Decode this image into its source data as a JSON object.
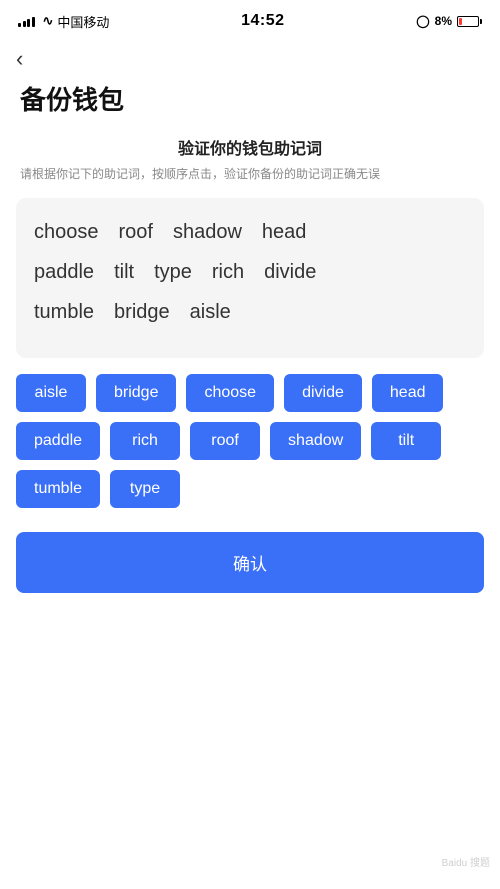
{
  "statusBar": {
    "carrier": "中国移动",
    "time": "14:52",
    "battery": "8%"
  },
  "back": {
    "icon": "‹"
  },
  "pageTitle": "备份钱包",
  "section": {
    "title": "验证你的钱包助记词",
    "desc": "请根据你记下的助记词，按顺序点击，验证你备份的助记词正确无误"
  },
  "displayWords": {
    "row1": [
      "choose",
      "roof",
      "shadow",
      "head"
    ],
    "row2": [
      "paddle",
      "tilt",
      "type",
      "rich",
      "divide"
    ],
    "row3": [
      "tumble",
      "bridge",
      "aisle"
    ]
  },
  "chips": [
    "aisle",
    "bridge",
    "choose",
    "divide",
    "head",
    "paddle",
    "rich",
    "roof",
    "shadow",
    "tilt",
    "tumble",
    "type"
  ],
  "confirmButton": "确认",
  "watermark": "Baidu 搜题"
}
